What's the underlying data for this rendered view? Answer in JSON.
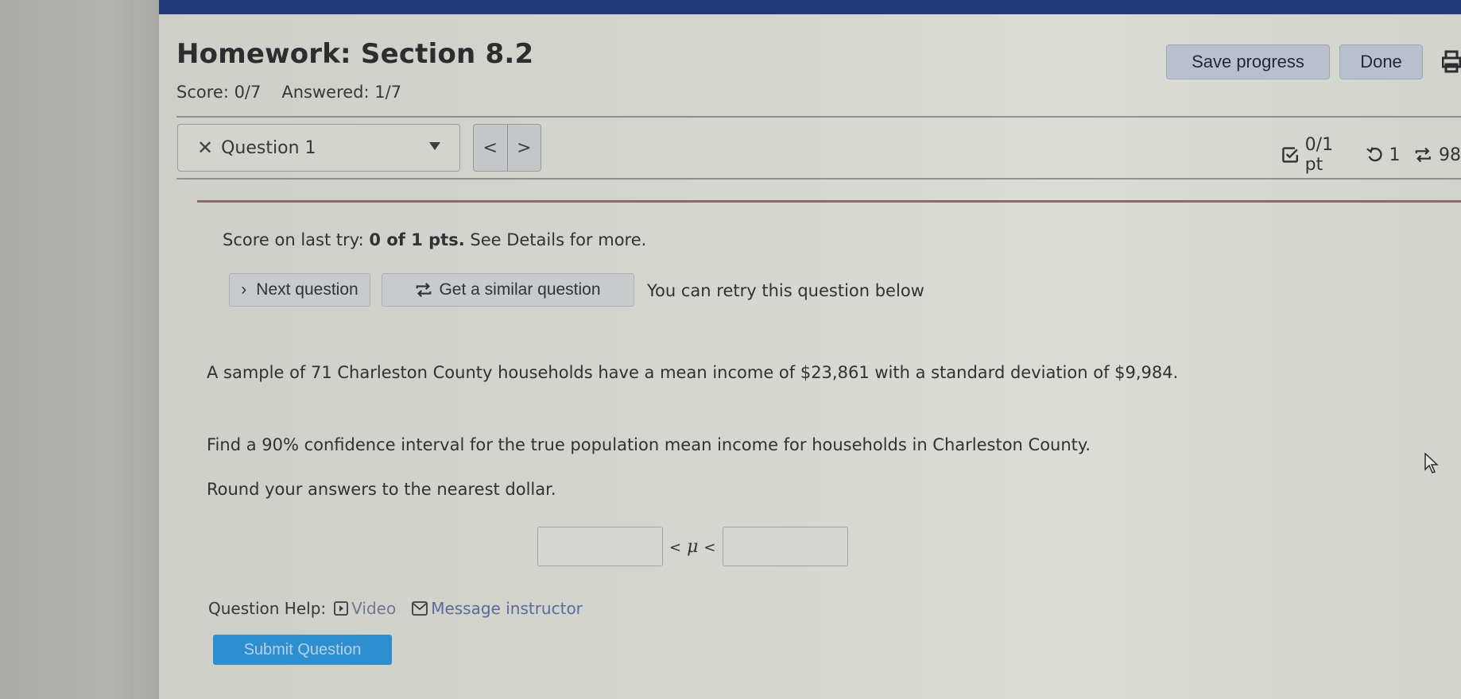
{
  "header": {
    "title": "Homework: Section 8.2",
    "score": "Score: 0/7",
    "answered": "Answered: 1/7",
    "save_label": "Save progress",
    "done_label": "Done"
  },
  "question_nav": {
    "selected": "Question 1",
    "prev_label": "<",
    "next_label": ">",
    "points": "0/1 pt",
    "retries": "1",
    "similar_count": "98"
  },
  "feedback": {
    "prefix": "Score on last try: ",
    "score_bold": "0 of 1 pts.",
    "suffix": " See Details for more.",
    "next_question_label": "Next question",
    "similar_question_label": "Get a similar question",
    "retry_note": "You can retry this question below"
  },
  "question": {
    "paragraph1": "A sample of 71 Charleston County households have a mean income of $23,861 with a standard deviation of $9,984.",
    "paragraph2": "Find a 90% confidence interval for the true population mean income for households in Charleston County.",
    "paragraph3": "Round your answers to the nearest dollar.",
    "lower_value": "",
    "upper_value": "",
    "symbol": "μ",
    "lt": "<"
  },
  "help": {
    "label": "Question Help:",
    "video_label": "Video",
    "message_label": "Message instructor"
  },
  "submit_label": "Submit Question",
  "colors": {
    "top_bar": "#233a78",
    "submit": "#2e8fd0",
    "error_border": "#8a6a6c",
    "link": "#5a6b9a"
  }
}
